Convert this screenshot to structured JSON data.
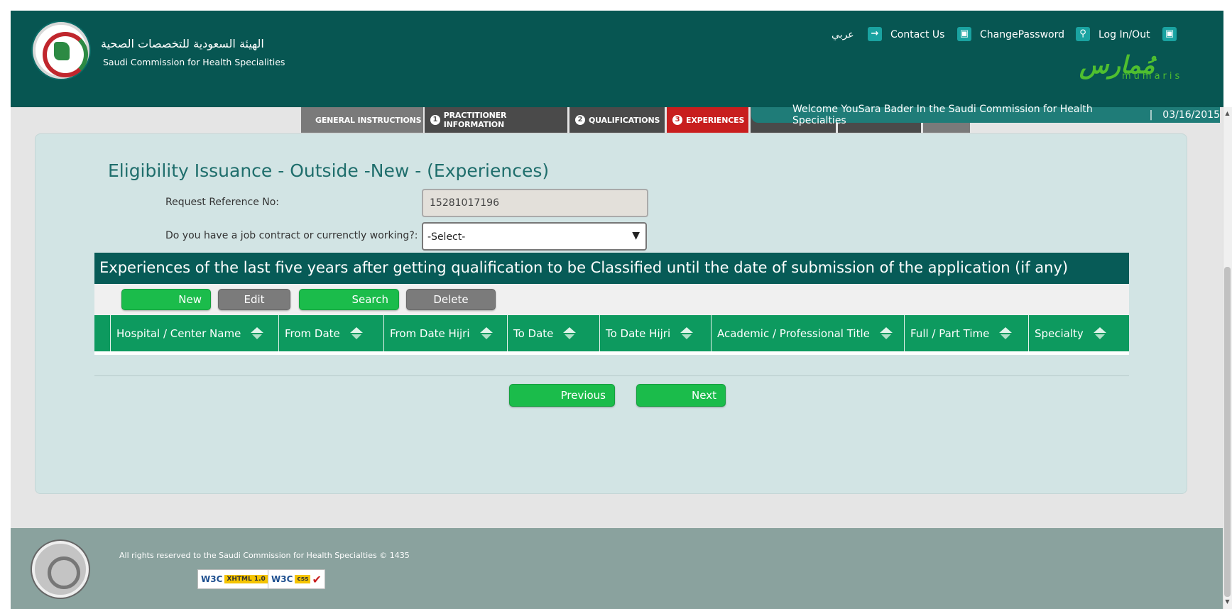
{
  "header": {
    "org_name_ar": "الهيئة السعودية للتخصصات الصحية",
    "org_name_en": "Saudi Commission for Health Specialities",
    "nav": {
      "language": "عربي",
      "contact": "Contact Us",
      "change_password": "ChangePassword",
      "login_out": "Log In/Out"
    },
    "mumaris_ar": "مُمارس",
    "mumaris_en": "mumaris"
  },
  "tabs": {
    "general": "GENERAL INSTRUCTIONS",
    "practitioner_num": "1",
    "practitioner": "PRACTITIONER INFORMATION",
    "qualifications_num": "2",
    "qualifications": "QUALIFICATIONS",
    "experiences_num": "3",
    "experiences": "EXPERIENCES"
  },
  "welcome": {
    "text": "Welcome YouSara Bader In the Saudi Commission for Health Specialties",
    "separator": "|",
    "date": "03/16/2015"
  },
  "form": {
    "title": "Eligibility Issuance - Outside -New - (Experiences)",
    "ref_label": "Request Reference No:",
    "ref_value": "15281017196",
    "contract_label": "Do you have a job contract or currenctly working?:",
    "contract_selected": "-Select-"
  },
  "experiences": {
    "heading": "Experiences of the last five years after getting qualification to be Classified until the date of submission of the application (if any)",
    "toolbar": {
      "new": "New",
      "edit": "Edit",
      "search": "Search",
      "delete": "Delete"
    },
    "columns": {
      "hospital": "Hospital / Center Name",
      "from_date": "From Date",
      "from_date_hijri": "From Date Hijri",
      "to_date": "To Date",
      "to_date_hijri": "To Date Hijri",
      "title": "Academic / Professional Title",
      "time": "Full / Part Time",
      "specialty": "Specialty"
    }
  },
  "navigation": {
    "previous": "Previous",
    "next": "Next"
  },
  "footer": {
    "copyright": "All rights reserved to the Saudi Commission for Health Specialties © 1435",
    "w3c": "W3C",
    "xhtml": "XHTML 1.0",
    "css": "css"
  },
  "colors": {
    "header_bg": "#075652",
    "accent_green": "#1bbc4b",
    "active_tab": "#c81e1e",
    "grid_header": "#0d9a5f"
  }
}
